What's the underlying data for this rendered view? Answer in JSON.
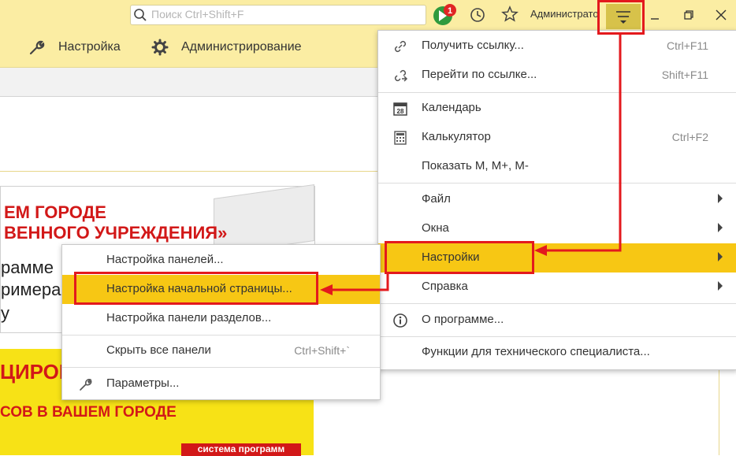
{
  "titlebar": {
    "search_placeholder": "Поиск Ctrl+Shift+F",
    "notification_count": "1",
    "user": "Администратор"
  },
  "toolbar": {
    "settings_label": "Настройка",
    "admin_label": "Администрирование"
  },
  "banner": {
    "line1": "ЕМ ГОРОДЕ",
    "line2": "ВЕННОГО УЧРЕЖДЕНИЯ»",
    "line3": "рамме",
    "line4": "римерах",
    "line5": "у",
    "promo1": "ЦИРОВ",
    "promo2": "СОВ В ВАШЕМ ГОРОДЕ",
    "promo3": "система программ"
  },
  "menu": {
    "get_link": "Получить ссылку...",
    "get_link_sc": "Ctrl+F11",
    "go_link": "Перейти по ссылке...",
    "go_link_sc": "Shift+F11",
    "calendar": "Календарь",
    "calendar_day": "28",
    "calculator": "Калькулятор",
    "calculator_sc": "Ctrl+F2",
    "show_m": "Показать M, M+, M-",
    "file": "Файл",
    "windows": "Окна",
    "settings": "Настройки",
    "help": "Справка",
    "about": "О программе...",
    "tech": "Функции для технического специалиста..."
  },
  "submenu": {
    "panels": "Настройка панелей...",
    "home": "Настройка начальной страницы...",
    "sections": "Настройка панели разделов...",
    "hide_all": "Скрыть все панели",
    "hide_all_sc": "Ctrl+Shift+`",
    "params": "Параметры..."
  },
  "colors": {
    "accent": "#fbeda3",
    "highlight": "#f7c714",
    "annotation": "#e3191d"
  }
}
